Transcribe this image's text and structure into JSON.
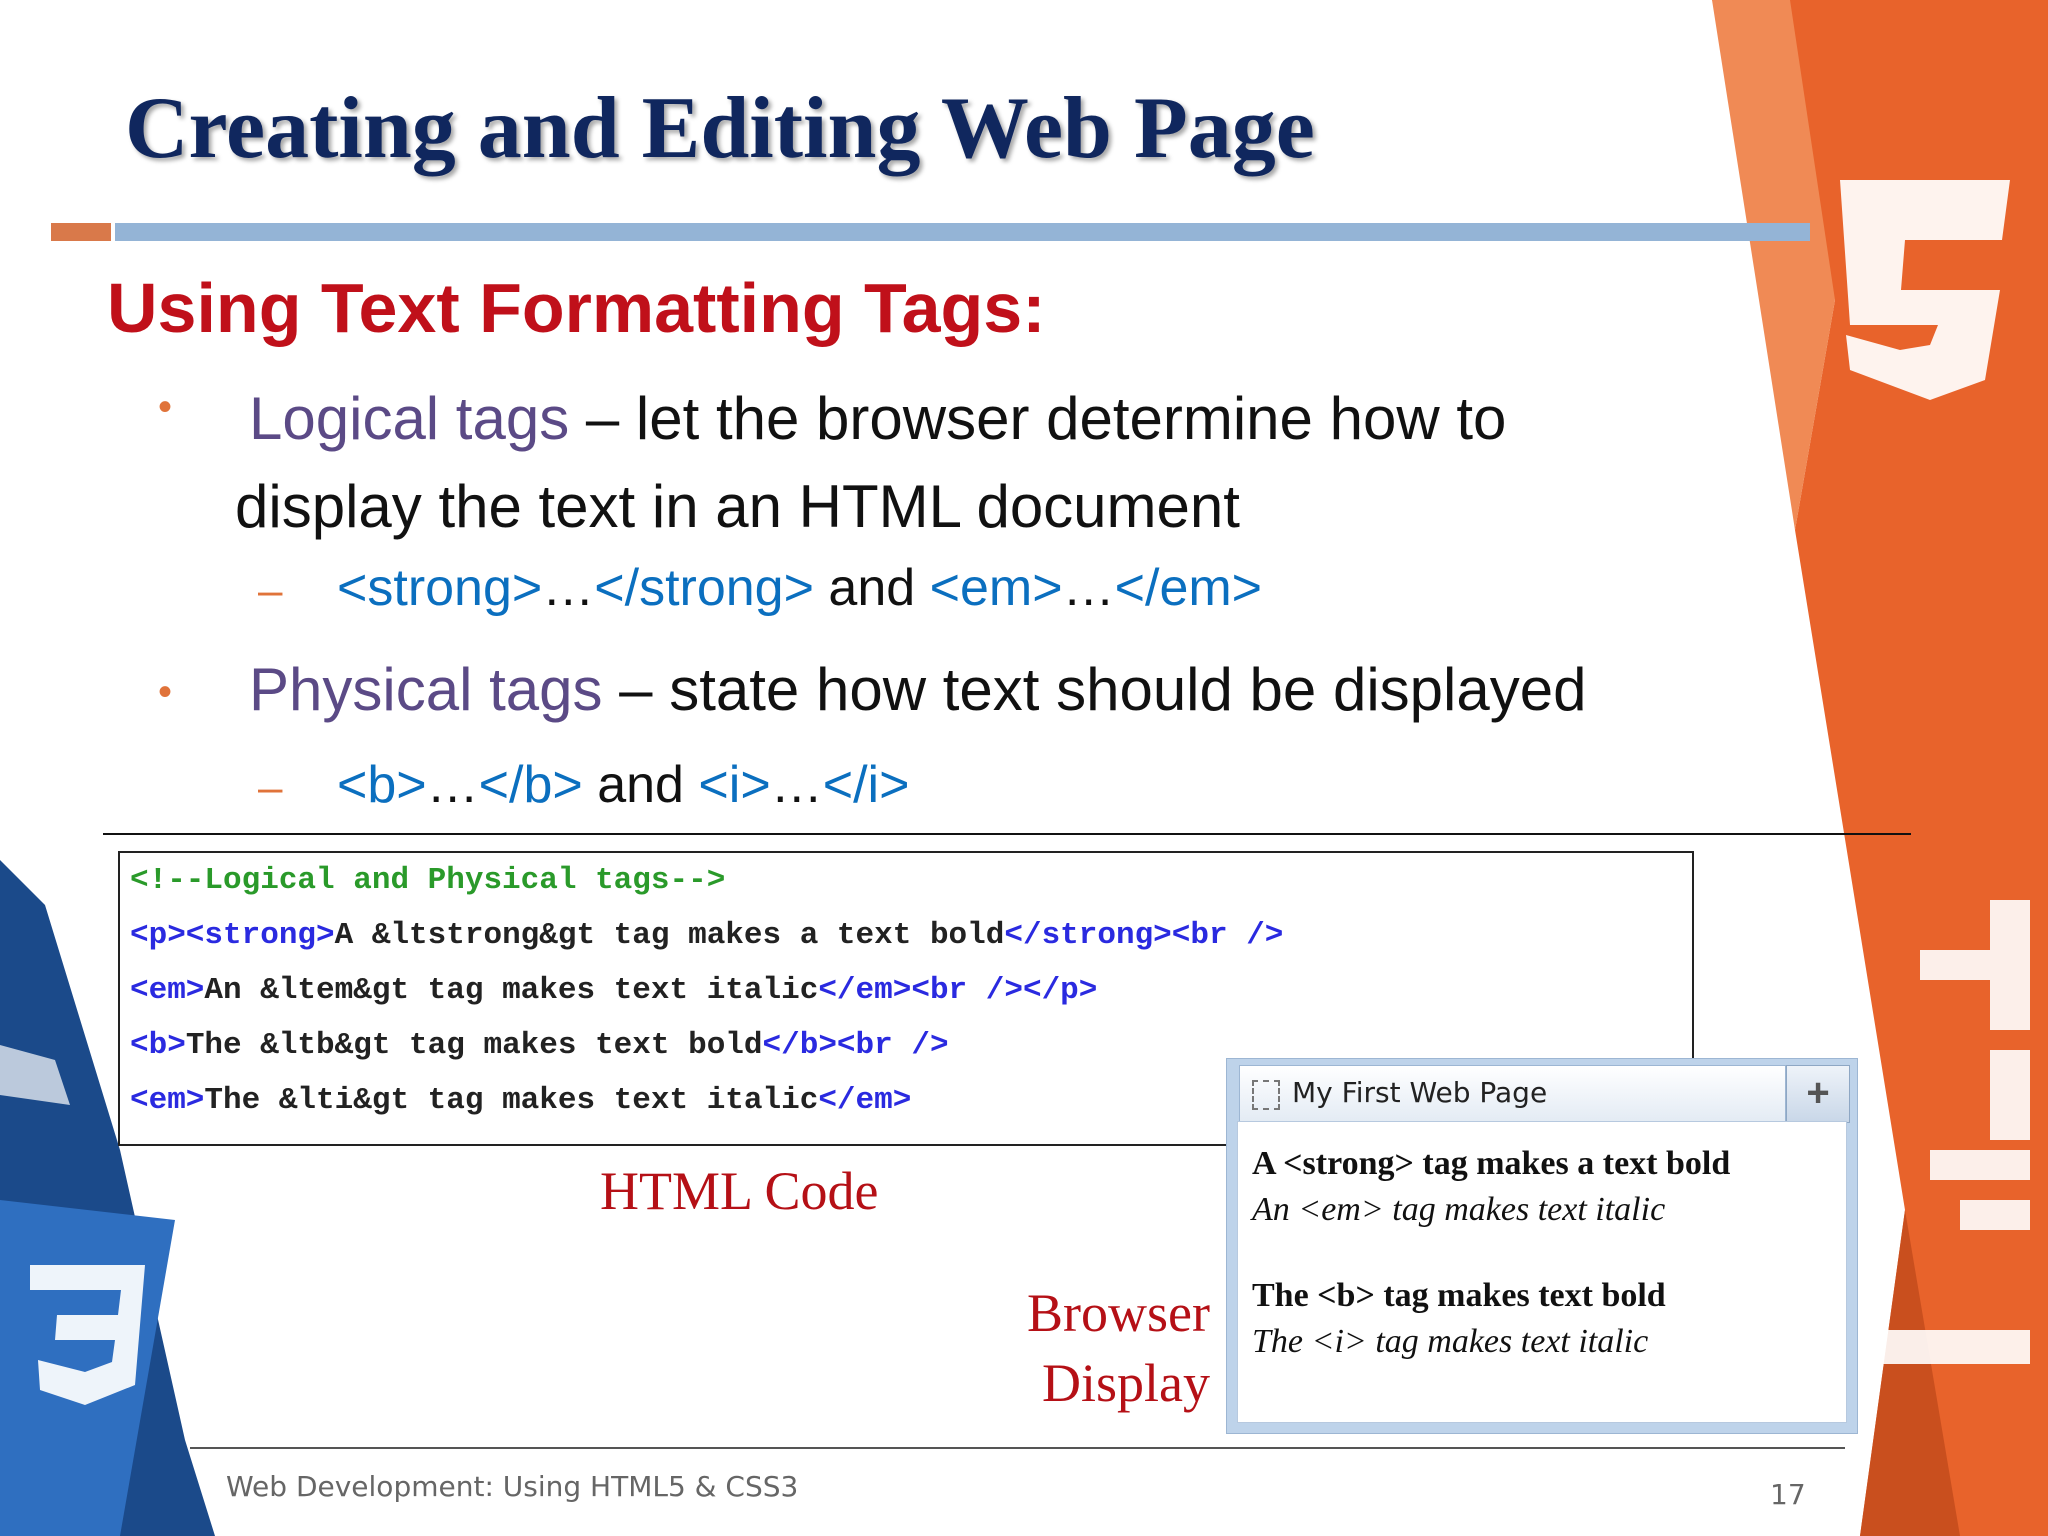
{
  "title": "Creating and Editing Web Page",
  "subtitle": "Using Text Formatting Tags:",
  "bullets": [
    {
      "term": "Logical tags",
      "line1": " – let the browser determine how to",
      "line2": "display the text in an HTML document",
      "sub_open": "<strong>",
      "sub_ellipsis1": "…",
      "sub_close": "</strong>",
      "sub_and": " and ",
      "sub_open2": "<em>",
      "sub_ellipsis2": "…",
      "sub_close2": "</em>"
    },
    {
      "term": "Physical tags",
      "line1": " – state how text should be displayed",
      "sub_open": "<b>",
      "sub_ellipsis1": "…",
      "sub_close": "</b>",
      "sub_and": " and ",
      "sub_open2": "<i>",
      "sub_ellipsis2": "…",
      "sub_close2": "</i>"
    }
  ],
  "code": {
    "line1": "<!--Logical and Physical tags-->",
    "line2": {
      "t1": "<p><strong>",
      "txt": "A &ltstrong&gt tag makes a text bold",
      "t2": "</strong><br />"
    },
    "line3": {
      "t1": "<em>",
      "txt": "An &ltem&gt tag makes text italic",
      "t2": "</em><br /></p>"
    },
    "line4": {
      "t1": "<b>",
      "txt": "The &ltb&gt tag makes text bold",
      "t2": "</b><br />"
    },
    "line5": {
      "t1": "<em>",
      "txt": "The &lti&gt tag makes text italic",
      "t2": "</em>"
    }
  },
  "captions": {
    "html_code": "HTML Code",
    "browser_line1": "Browser",
    "browser_line2": "Display"
  },
  "browser": {
    "tab_title": "My First Web Page",
    "new_tab": "+",
    "lines": [
      "A <strong> tag makes a text bold",
      "An <em> tag makes text italic",
      "The <b> tag makes text bold",
      "The <i> tag makes text italic"
    ]
  },
  "footer": {
    "text": "Web Development: Using HTML5 & CSS3",
    "page": "17"
  },
  "colors": {
    "title": "#10275e",
    "subtitle": "#c0101a",
    "accent_orange": "#e8632b",
    "accent_blue": "#94b4d6",
    "code_tag": "#2a2ae0",
    "code_comment": "#2a9a2a"
  }
}
